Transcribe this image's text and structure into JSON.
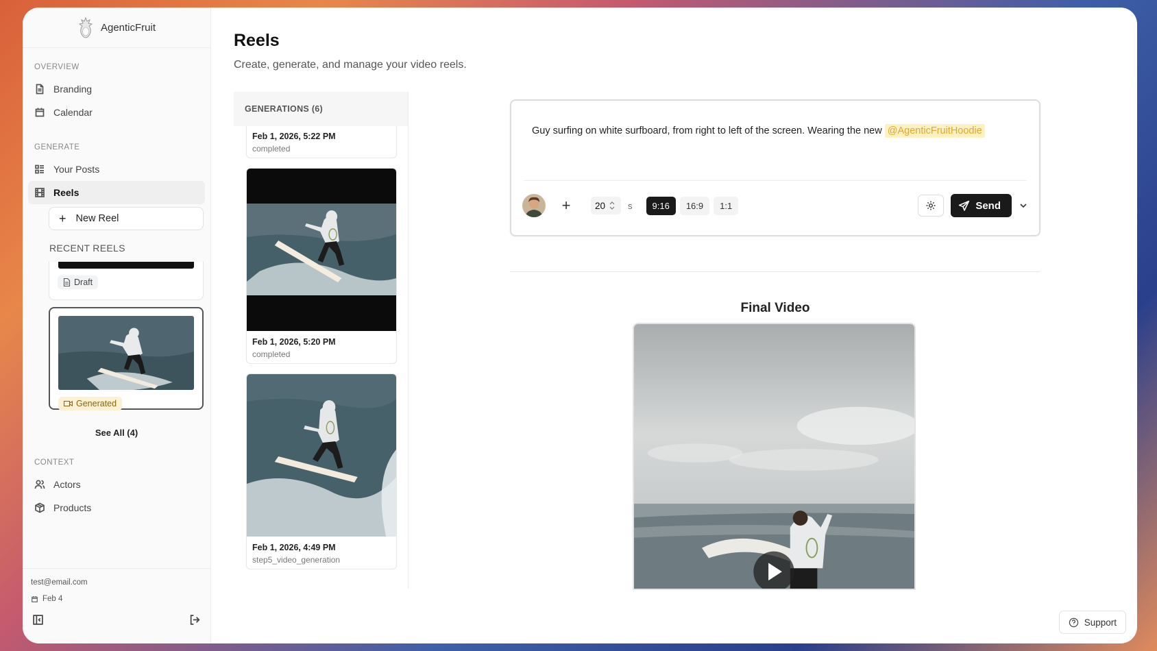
{
  "app": {
    "name": "AgenticFruit"
  },
  "sidebar": {
    "overview_label": "OVERVIEW",
    "overview_items": [
      {
        "label": "Branding",
        "icon": "document-icon"
      },
      {
        "label": "Calendar",
        "icon": "calendar-icon"
      }
    ],
    "generate_label": "GENERATE",
    "generate_items": [
      {
        "label": "Your Posts",
        "icon": "list-icon"
      },
      {
        "label": "Reels",
        "icon": "film-icon",
        "active": true
      }
    ],
    "new_reel_label": "New Reel",
    "recent_reels_label": "RECENT REELS",
    "recent_reels": [
      {
        "status": "Draft"
      },
      {
        "status": "Generated"
      }
    ],
    "see_all_label": "See All (4)",
    "context_label": "CONTEXT",
    "context_items": [
      {
        "label": "Actors",
        "icon": "users-icon"
      },
      {
        "label": "Products",
        "icon": "box-icon"
      }
    ],
    "footer": {
      "email": "test@email.com",
      "date": "Feb 4"
    }
  },
  "page": {
    "title": "Reels",
    "subtitle": "Create, generate, and manage your video reels."
  },
  "generations": {
    "header": "GENERATIONS (6)",
    "items": [
      {
        "date": "Feb 1, 2026, 5:22 PM",
        "status": "completed"
      },
      {
        "date": "Feb 1, 2026, 5:20 PM",
        "status": "completed"
      },
      {
        "date": "Feb 1, 2026, 4:49 PM",
        "status": "step5_video_generation"
      }
    ]
  },
  "prompt": {
    "text": "Guy surfing on white surfboard, from right to left of the screen. Wearing the new",
    "mention": "@AgenticFruitHoodie",
    "duration_value": "20",
    "duration_unit": "s",
    "aspect_ratios": [
      "9:16",
      "16:9",
      "1:1"
    ],
    "selected_aspect": "9:16",
    "send_label": "Send"
  },
  "final_video": {
    "title": "Final Video"
  },
  "support_label": "Support",
  "colors": {
    "accent_dark": "#1a1a1a",
    "mention_bg": "#fdf0c2",
    "mention_text": "#e0a92b",
    "generated_badge_bg": "#fdf1d3"
  }
}
